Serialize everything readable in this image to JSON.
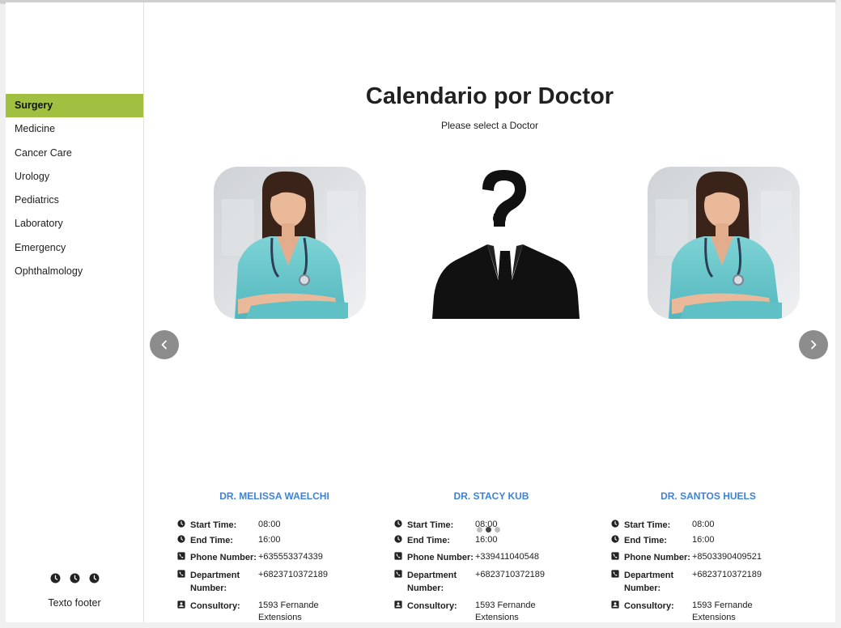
{
  "sidebar": {
    "items": [
      {
        "label": "Surgery",
        "active": true
      },
      {
        "label": "Medicine",
        "active": false
      },
      {
        "label": "Cancer Care",
        "active": false
      },
      {
        "label": "Urology",
        "active": false
      },
      {
        "label": "Pediatrics",
        "active": false
      },
      {
        "label": "Laboratory",
        "active": false
      },
      {
        "label": "Emergency",
        "active": false
      },
      {
        "label": "Ophthalmology",
        "active": false
      }
    ],
    "footer_icons": [
      "clock-icon",
      "clock-icon",
      "clock-icon"
    ],
    "footer_text": "Texto footer"
  },
  "header": {
    "title": "Calendario por Doctor",
    "subtitle": "Please select a Doctor"
  },
  "labels": {
    "start_time": "Start Time:",
    "end_time": "End Time:",
    "phone_number": "Phone Number:",
    "department_number": "Department Number:",
    "consultory": "Consultory:"
  },
  "doctors": [
    {
      "name": "DR. MELISSA WAELCHI",
      "photo": "nurse-photo",
      "start_time": "08:00",
      "end_time": "16:00",
      "phone_number": "+635553374339",
      "department_number": "+6823710372189",
      "consultory": "1593 Fernande Extensions"
    },
    {
      "name": "DR. STACY KUB",
      "photo": "unknown-person-silhouette",
      "start_time": "08:00",
      "end_time": "16:00",
      "phone_number": "+339411040548",
      "department_number": "+6823710372189",
      "consultory": "1593 Fernande Extensions"
    },
    {
      "name": "DR. SANTOS HUELS",
      "photo": "nurse-photo",
      "start_time": "08:00",
      "end_time": "16:00",
      "phone_number": "+8503390409521",
      "department_number": "+6823710372189",
      "consultory": "1593 Fernande Extensions"
    }
  ],
  "card_actions": [
    "heart-icon",
    "photo-library-icon",
    "photo-library-icon"
  ],
  "carousel": {
    "pages": 3,
    "current_page": 2
  },
  "colors": {
    "active_nav": "#a1c042",
    "doctor_name": "#3d82d8",
    "action_icon": "#2f7fe0",
    "arrow_bg": "#8c8c8c"
  }
}
